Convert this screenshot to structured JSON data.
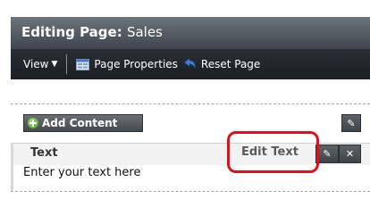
{
  "title_bar": {
    "prefix": "Editing Page:",
    "page_name": "Sales"
  },
  "toolbar": {
    "view_label": "View",
    "page_properties_label": "Page Properties",
    "reset_page_label": "Reset Page"
  },
  "add_content": {
    "label": "Add Content"
  },
  "region": {
    "title": "Text",
    "edit_text_label": "Edit Text",
    "body_text": "Enter your text here"
  },
  "colors": {
    "titlebar": "#4f555c",
    "toolbar": "#22272c",
    "highlight": "#e0101a"
  },
  "icons": {
    "view_menu": "chevron-down-icon",
    "page_properties": "page-properties-icon",
    "reset_page": "reset-arrow-icon",
    "add_content": "plus-icon",
    "edit": "pencil-icon",
    "close": "close-icon"
  }
}
